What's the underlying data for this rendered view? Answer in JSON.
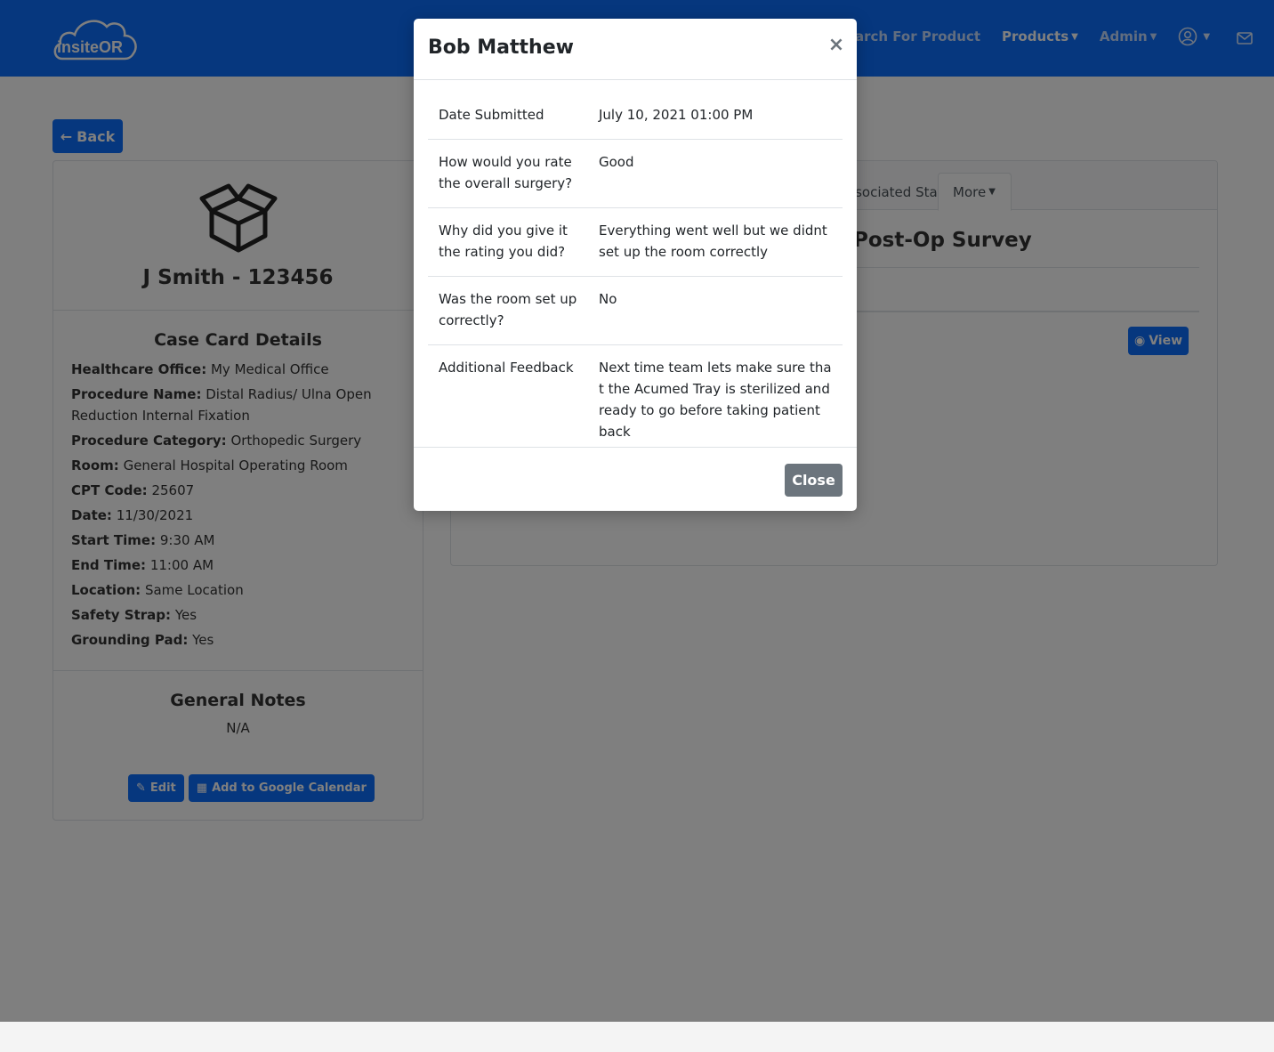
{
  "navbar": {
    "brand": "insiteOR",
    "links": [
      "Search For Product",
      "Products",
      "Admin"
    ]
  },
  "page": {
    "back_label": "Back",
    "case_title": "J Smith - 123456",
    "case_card_title": "Case Card Details",
    "details": [
      {
        "label": "Healthcare Office:",
        "value": "My Medical Office"
      },
      {
        "label": "Procedure Name:",
        "value": "Distal Radius/ Ulna Open Reduction Internal Fixation"
      },
      {
        "label": "Procedure Category:",
        "value": "Orthopedic Surgery"
      },
      {
        "label": "Room:",
        "value": "General Hospital Operating Room"
      },
      {
        "label": "CPT Code:",
        "value": "25607"
      },
      {
        "label": "Date:",
        "value": "11/30/2021"
      },
      {
        "label": "Start Time:",
        "value": "9:30 AM"
      },
      {
        "label": "End Time:",
        "value": "11:00 AM"
      },
      {
        "label": "Location:",
        "value": "Same Location"
      },
      {
        "label": "Safety Strap:",
        "value": "Yes"
      },
      {
        "label": "Grounding Pad:",
        "value": "Yes"
      }
    ],
    "general_notes_title": "General Notes",
    "general_notes_value": "N/A",
    "edit_label": "Edit",
    "calendar_label": "Add to Google Calendar",
    "tabs": [
      "Associated Staff",
      "More"
    ],
    "survey_title": "Post-Op Survey",
    "view_label": "View"
  },
  "modal": {
    "title": "Bob Matthew",
    "close_x": "×",
    "rows": [
      {
        "question": "Date Submitted",
        "answer": "July 10, 2021 01:00 PM"
      },
      {
        "question": "How would you rate the overall surgery?",
        "answer": "Good"
      },
      {
        "question": "Why did you give it the rating you did?",
        "answer": "Everything went well but we didnt set up the room correctly"
      },
      {
        "question": "Was the room set up correctly?",
        "answer": "No"
      },
      {
        "question": "Additional Feedback",
        "answer": "Next time team lets make sure that the Acumed Tray is sterilized and ready to go before taking patient back"
      }
    ],
    "close_label": "Close"
  },
  "colors": {
    "primary": "#0d6efd",
    "secondary": "#6c757d",
    "backdrop": "rgba(0,0,0,0.5)"
  },
  "icons": [
    "cloud-logo-icon",
    "arrow-left-icon",
    "open-box-icon",
    "user-circle-icon",
    "envelope-icon",
    "edit-icon",
    "calendar-icon",
    "eye-icon",
    "chevron-down-icon",
    "close-icon"
  ]
}
